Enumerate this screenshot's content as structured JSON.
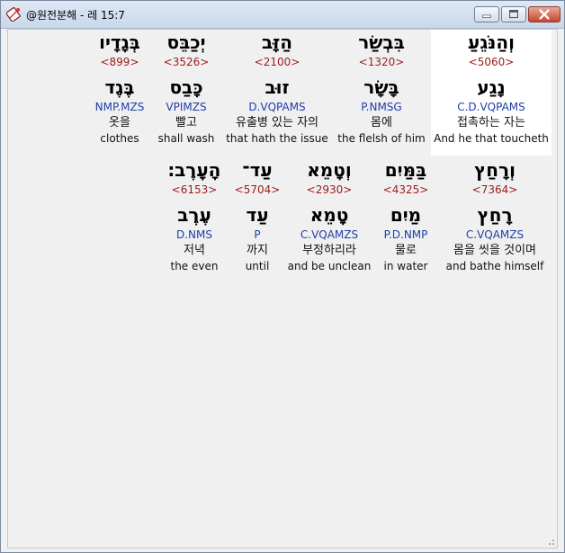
{
  "window": {
    "title": "@원전분해 - 레 15:7"
  },
  "row1": [
    {
      "hebrew": "וְהַנֹּגֵעַ",
      "strong": "<5060>",
      "lexeme": "נָגַע",
      "morph": "C.D.VQPAMS",
      "korean": "접촉하는 자는",
      "english": "And he that toucheth",
      "highlight": true
    },
    {
      "hebrew": "בִּבְשַׂר",
      "strong": "<1320>",
      "lexeme": "בָּשָׂר",
      "morph": "P.NMSG",
      "korean": "몸에",
      "english": "the flelsh of him",
      "highlight": false
    },
    {
      "hebrew": "הַזָּב",
      "strong": "<2100>",
      "lexeme": "זוּב",
      "morph": "D.VQPAMS",
      "korean": "유출병 있는 자의",
      "english": "that hath the issue",
      "highlight": false
    },
    {
      "hebrew": "יְכַבֵּס",
      "strong": "<3526>",
      "lexeme": "כָּבַס",
      "morph": "VPIMZS",
      "korean": "빨고",
      "english": "shall wash",
      "highlight": false
    },
    {
      "hebrew": "בְּגָדָיו",
      "strong": "<899>",
      "lexeme": "בֶּגֶד",
      "morph": "NMP.MZS",
      "korean": "옷을",
      "english": "clothes",
      "highlight": false
    }
  ],
  "row2": [
    {
      "hebrew": "וְרָחַץ",
      "strong": "<7364>",
      "lexeme": "רָחַץ",
      "morph": "C.VQAMZS",
      "korean": "몸을 씻을 것이며",
      "english": "and bathe himself",
      "highlight": false
    },
    {
      "hebrew": "בַּמַּיִם",
      "strong": "<4325>",
      "lexeme": "מַיִם",
      "morph": "P.D.NMP",
      "korean": "물로",
      "english": "in water",
      "highlight": false
    },
    {
      "hebrew": "וְטָמֵא",
      "strong": "<2930>",
      "lexeme": "טָמֵא",
      "morph": "C.VQAMZS",
      "korean": "부정하리라",
      "english": "and be unclean",
      "highlight": false
    },
    {
      "hebrew": "עַד־",
      "strong": "<5704>",
      "lexeme": "עַד",
      "morph": "P",
      "korean": "까지",
      "english": "until",
      "highlight": false
    },
    {
      "hebrew": "הָעָֽרֶב׃",
      "strong": "<6153>",
      "lexeme": "עֶרֶב",
      "morph": "D.NMS",
      "korean": "저녁",
      "english": "the even",
      "highlight": false
    }
  ],
  "icons": {
    "app": "bible-book-icon",
    "minimize": "minimize-icon",
    "maximize": "maximize-icon",
    "close": "close-icon"
  }
}
